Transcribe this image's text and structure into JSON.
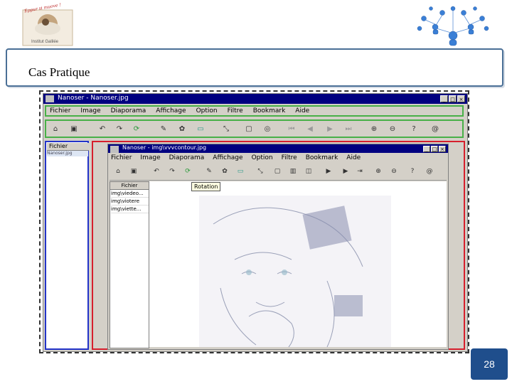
{
  "header": {
    "logo_motto": "Eppur si muove !",
    "logo_name": "Institut Galilée"
  },
  "slide_title": "Cas Pratique",
  "app": {
    "window_title": "Nanoser - Nanoser.jpg",
    "menu": [
      "Fichier",
      "Image",
      "Diaporama",
      "Affichage",
      "Option",
      "Filtre",
      "Bookmark",
      "Aide"
    ],
    "toolbar_icons": [
      "open-icon",
      "save-icon",
      "undo-icon",
      "redo-icon",
      "refresh-icon",
      "brush-icon",
      "palette-icon",
      "display-icon",
      "resize-icon",
      "frame-icon",
      "rotate-icon",
      "first-icon",
      "prev-icon",
      "next-icon",
      "last-icon",
      "zoom-in-icon",
      "zoom-out-icon",
      "help-icon",
      "about-icon"
    ],
    "left_panel": {
      "header": "Fichier",
      "item": "Nanoser.jpg"
    },
    "inner_window": {
      "title": "Nanoser - img\\vvvcontour.jpg",
      "menu": [
        "Fichier",
        "Image",
        "Diaporama",
        "Affichage",
        "Option",
        "Filtre",
        "Bookmark",
        "Aide"
      ],
      "file_header": "Fichier",
      "files": [
        "img\\viedeo...",
        "img\\viotere",
        "img\\viette..."
      ],
      "tooltip": "Rotation"
    }
  },
  "page_number": "28",
  "colors": {
    "title_border": "#4a6f96",
    "menu_highlight": "#48b048",
    "left_highlight": "#2333c8",
    "right_highlight": "#d61f2d",
    "page_badge": "#1f4e8c"
  }
}
